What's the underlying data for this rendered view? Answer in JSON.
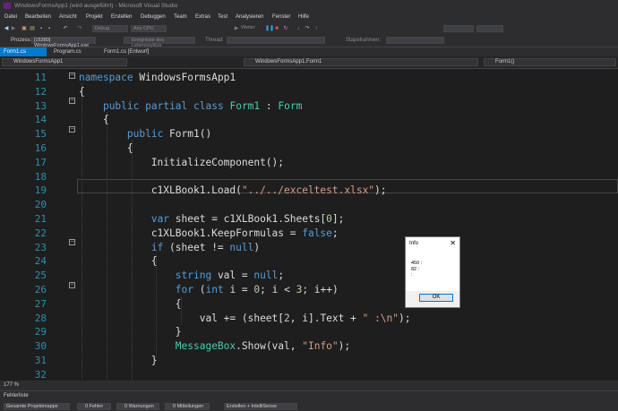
{
  "window": {
    "title": "WindowsFormsApp1 (wird ausgeführt) - Microsoft Visual Studio"
  },
  "menu": [
    "Datei",
    "Bearbeiten",
    "Ansicht",
    "Projekt",
    "Erstellen",
    "Debuggen",
    "Team",
    "Extras",
    "Test",
    "Analysieren",
    "Fenster",
    "Hilfe"
  ],
  "toolbar": {
    "config": "Debug",
    "platform": "Any CPU",
    "continue": "Weiter"
  },
  "process": {
    "label": "Prozess:",
    "value": "[15380] WindowsFormsApp1.exe",
    "lifecycle": "Ereignisse des Lebenszyklus",
    "thread_label": "Thread:",
    "stackframe": "Stapelrahmen:"
  },
  "tabs": [
    "Form1.cs",
    "Program.cs",
    "Form1.cs [Entwurf]"
  ],
  "nav": {
    "project": "WindowsFormsApp1",
    "class": "WindowsFormsApp1.Form1",
    "member": "Form1()"
  },
  "code_lines": [
    {
      "num": "11",
      "text": "namespace WindowsFormsApp1"
    },
    {
      "num": "12",
      "text": "{"
    },
    {
      "num": "13",
      "text": "    public partial class Form1 : Form"
    },
    {
      "num": "14",
      "text": "    {"
    },
    {
      "num": "15",
      "text": "        public Form1()"
    },
    {
      "num": "16",
      "text": "        {"
    },
    {
      "num": "17",
      "text": "            InitializeComponent();"
    },
    {
      "num": "18",
      "text": ""
    },
    {
      "num": "19",
      "text": "            c1XLBook1.Load(\"../../exceltest.xlsx\");"
    },
    {
      "num": "20",
      "text": ""
    },
    {
      "num": "21",
      "text": "            var sheet = c1XLBook1.Sheets[0];"
    },
    {
      "num": "22",
      "text": "            c1XLBook1.KeepFormulas = false;"
    },
    {
      "num": "23",
      "text": "            if (sheet != null)"
    },
    {
      "num": "24",
      "text": "            {"
    },
    {
      "num": "25",
      "text": "                string val = null;"
    },
    {
      "num": "26",
      "text": "                for (int i = 0; i < 3; i++)"
    },
    {
      "num": "27",
      "text": "                {"
    },
    {
      "num": "28",
      "text": "                    val += (sheet[2, i].Text + \" :\\n\");"
    },
    {
      "num": "29",
      "text": "                }"
    },
    {
      "num": "30",
      "text": "                MessageBox.Show(val, \"Info\");"
    },
    {
      "num": "31",
      "text": "            }"
    },
    {
      "num": "32",
      "text": ""
    }
  ],
  "status": {
    "zoom": "177 %"
  },
  "error_list": {
    "title": "Fehlerliste",
    "scope": "Gesamte Projektmappe",
    "errors": "0 Fehler",
    "warnings": "0 Warnungen",
    "messages": "0 Mitteilungen",
    "build": "Erstellen + IntelliSense"
  },
  "messagebox": {
    "title": "Info",
    "text": "450 :\n82 :\n:",
    "ok": "OK"
  }
}
